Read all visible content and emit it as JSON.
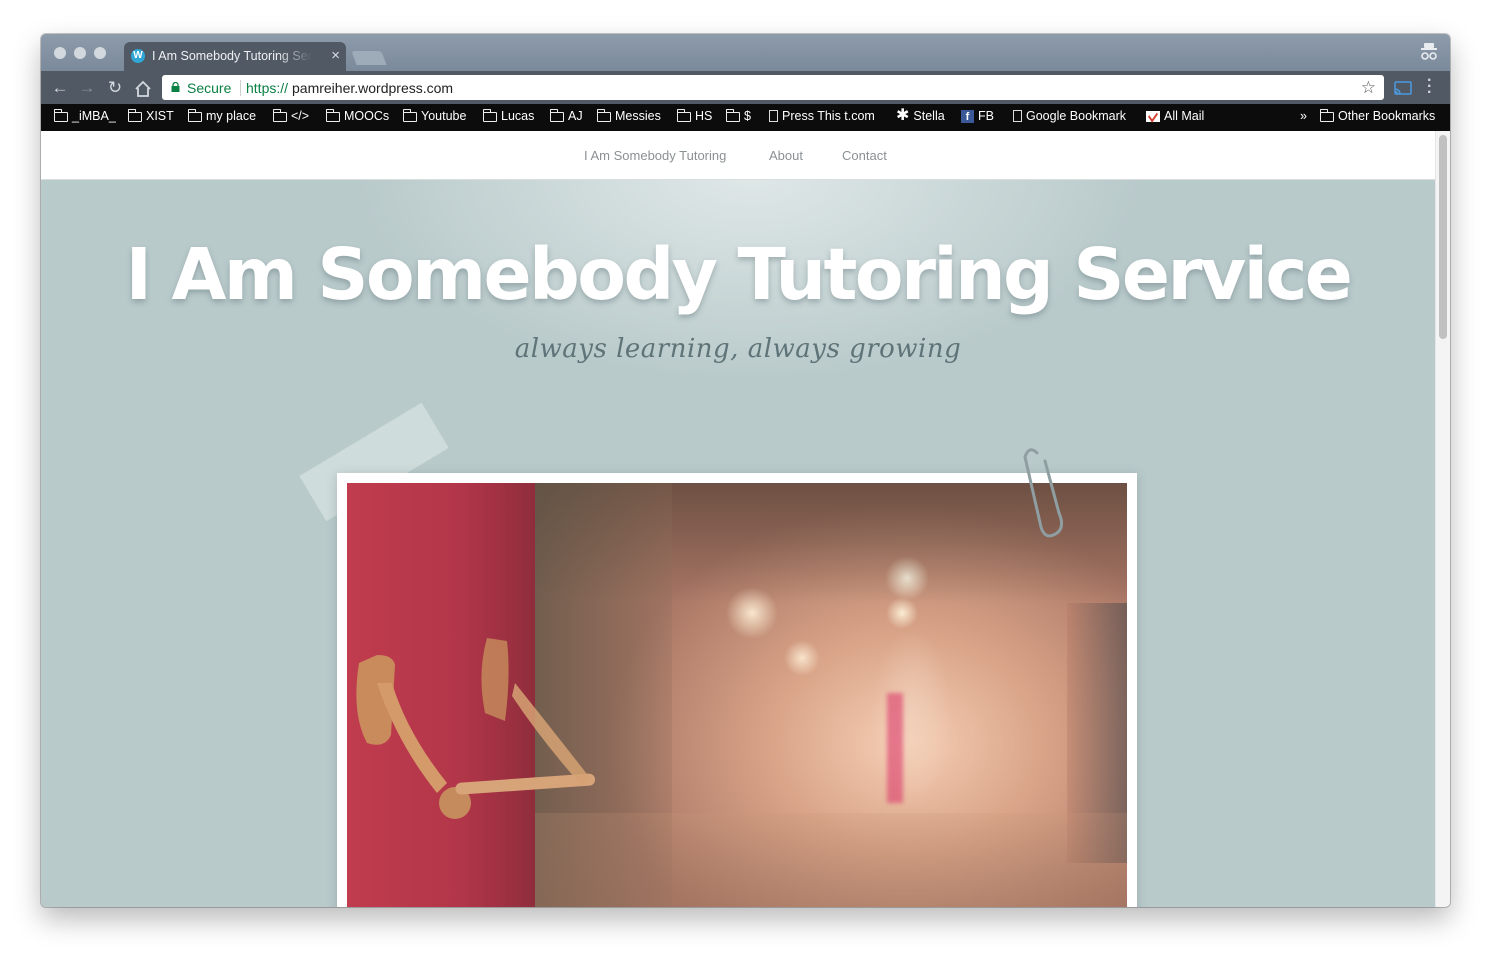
{
  "browser": {
    "tab": {
      "title": "I Am Somebody Tutoring Service",
      "favicon": "wordpress-icon"
    },
    "toolbar": {
      "secure_label": "Secure",
      "url_scheme": "https://",
      "url_host": "pamreiher.wordpress.com"
    },
    "bookmarks": {
      "items": [
        {
          "label": "_iMBA_",
          "icon": "folder-icon"
        },
        {
          "label": "XIST",
          "icon": "folder-icon"
        },
        {
          "label": "my place",
          "icon": "folder-icon"
        },
        {
          "label": "</>",
          "icon": "folder-icon"
        },
        {
          "label": "MOOCs",
          "icon": "folder-icon"
        },
        {
          "label": "Youtube",
          "icon": "folder-icon"
        },
        {
          "label": "Lucas",
          "icon": "folder-icon"
        },
        {
          "label": "AJ",
          "icon": "folder-icon"
        },
        {
          "label": "Messies",
          "icon": "folder-icon"
        },
        {
          "label": "HS",
          "icon": "folder-icon"
        },
        {
          "label": "$",
          "icon": "folder-icon"
        },
        {
          "label": "Press This t.com",
          "icon": "page-icon"
        },
        {
          "label": "Stella",
          "icon": "asterisk-icon"
        },
        {
          "label": "FB",
          "icon": "facebook-icon"
        },
        {
          "label": "Google Bookmark",
          "icon": "page-icon"
        },
        {
          "label": "All Mail",
          "icon": "gmail-icon"
        }
      ],
      "overflow_label": "»",
      "other_label": "Other Bookmarks"
    }
  },
  "site": {
    "nav": [
      "I Am Somebody Tutoring",
      "About",
      "Contact"
    ],
    "title": "I Am Somebody Tutoring Service",
    "tagline": "always learning, always growing",
    "more_label": "•••"
  },
  "colors": {
    "page_background": "#b9cacb",
    "title_text": "#ffffff",
    "tagline_text": "#5f7478",
    "tab_strip": "#8d9bab",
    "toolbar": "#515a64",
    "secure_green": "#0b8043"
  }
}
